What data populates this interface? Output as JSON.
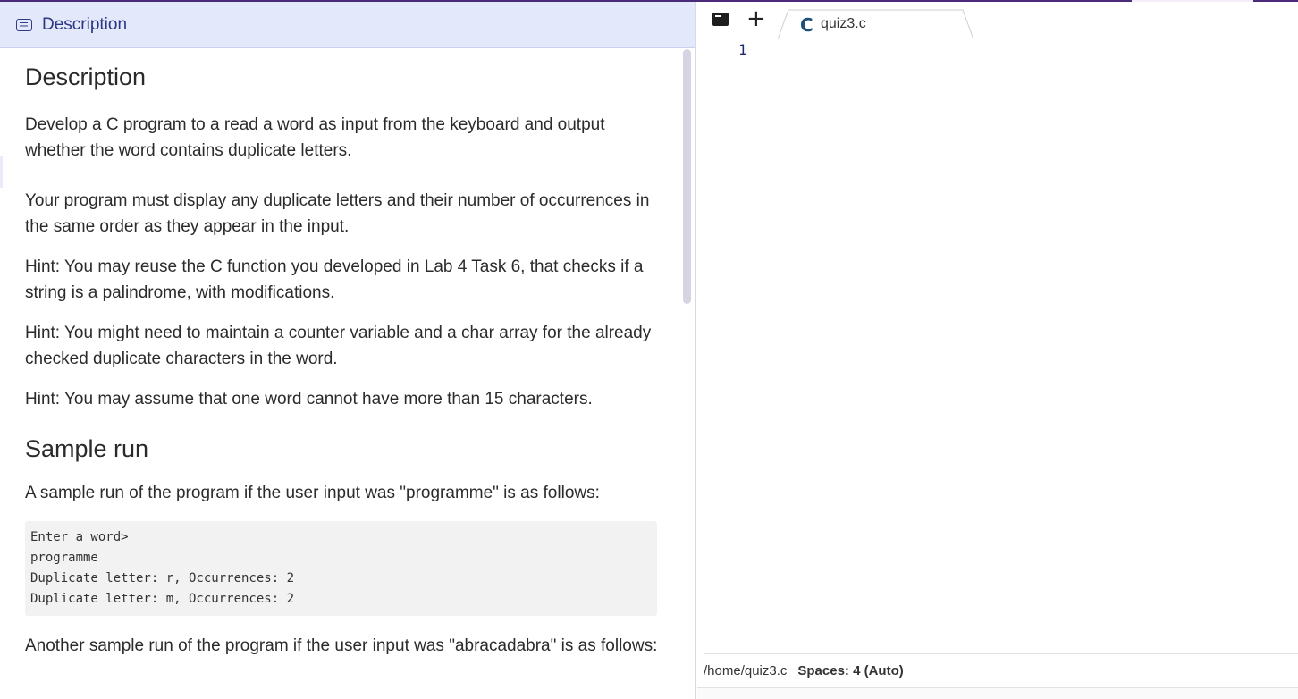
{
  "description_panel": {
    "header_title": "Description",
    "heading": "Description",
    "paragraphs": [
      "Develop a C program to a read a word as input from the keyboard and output whether the word contains duplicate letters.",
      "Your program must display any duplicate letters and their number of occurrences in the same order as they appear in the input.",
      "Hint: You may reuse the C function you developed in Lab 4 Task 6, that checks if a string is a palindrome, with modifications.",
      "Hint: You might need to maintain a counter variable and a char array for the already checked duplicate characters in the word.",
      "Hint: You may assume that one word cannot have more than 15 characters."
    ],
    "sample_heading": "Sample run",
    "sample_intro": "A sample run of the program if the user input was \"programme\" is as follows:",
    "sample_code": [
      "Enter a word>",
      "programme",
      "Duplicate letter: r, Occurrences: 2",
      "Duplicate letter: m, Occurrences: 2"
    ],
    "another_sample_intro": "Another sample run of the program if the user input was \"abracadabra\" is as follows:"
  },
  "editor": {
    "tab_filename": "quiz3.c",
    "tab_icon": "c-language-icon",
    "line_numbers": [
      "1"
    ],
    "status_path": "/home/quiz3.c",
    "status_spaces": "Spaces: 4 (Auto)"
  },
  "colors": {
    "header_bg": "#e3e8fb",
    "header_text": "#2a3784",
    "top_accent": "#4b2a7a"
  }
}
